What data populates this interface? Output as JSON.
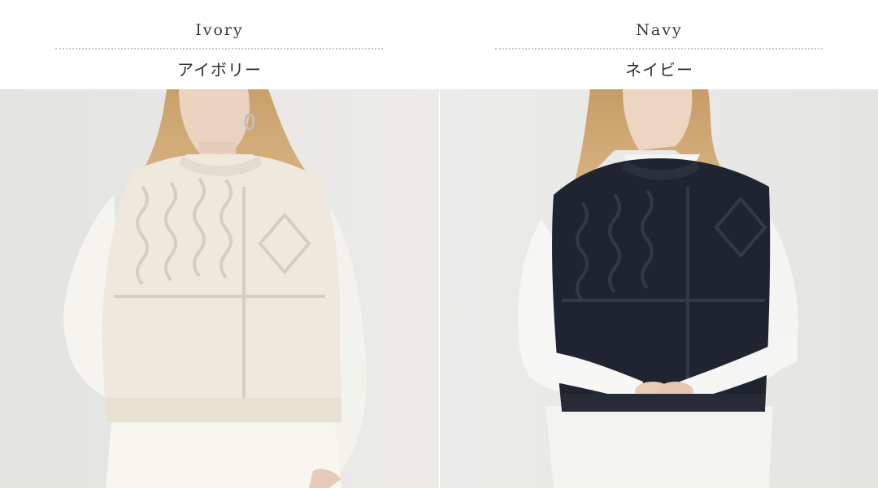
{
  "colors": [
    {
      "name_en": "Ivory",
      "name_ja": "アイボリー",
      "swatch": "#efe9dd",
      "photo_alt": "Model wearing ivory cable-knit vest over white shirt"
    },
    {
      "name_en": "Navy",
      "name_ja": "ネイビー",
      "swatch": "#1f2430",
      "photo_alt": "Model wearing navy cable-knit vest over white shirt"
    }
  ]
}
